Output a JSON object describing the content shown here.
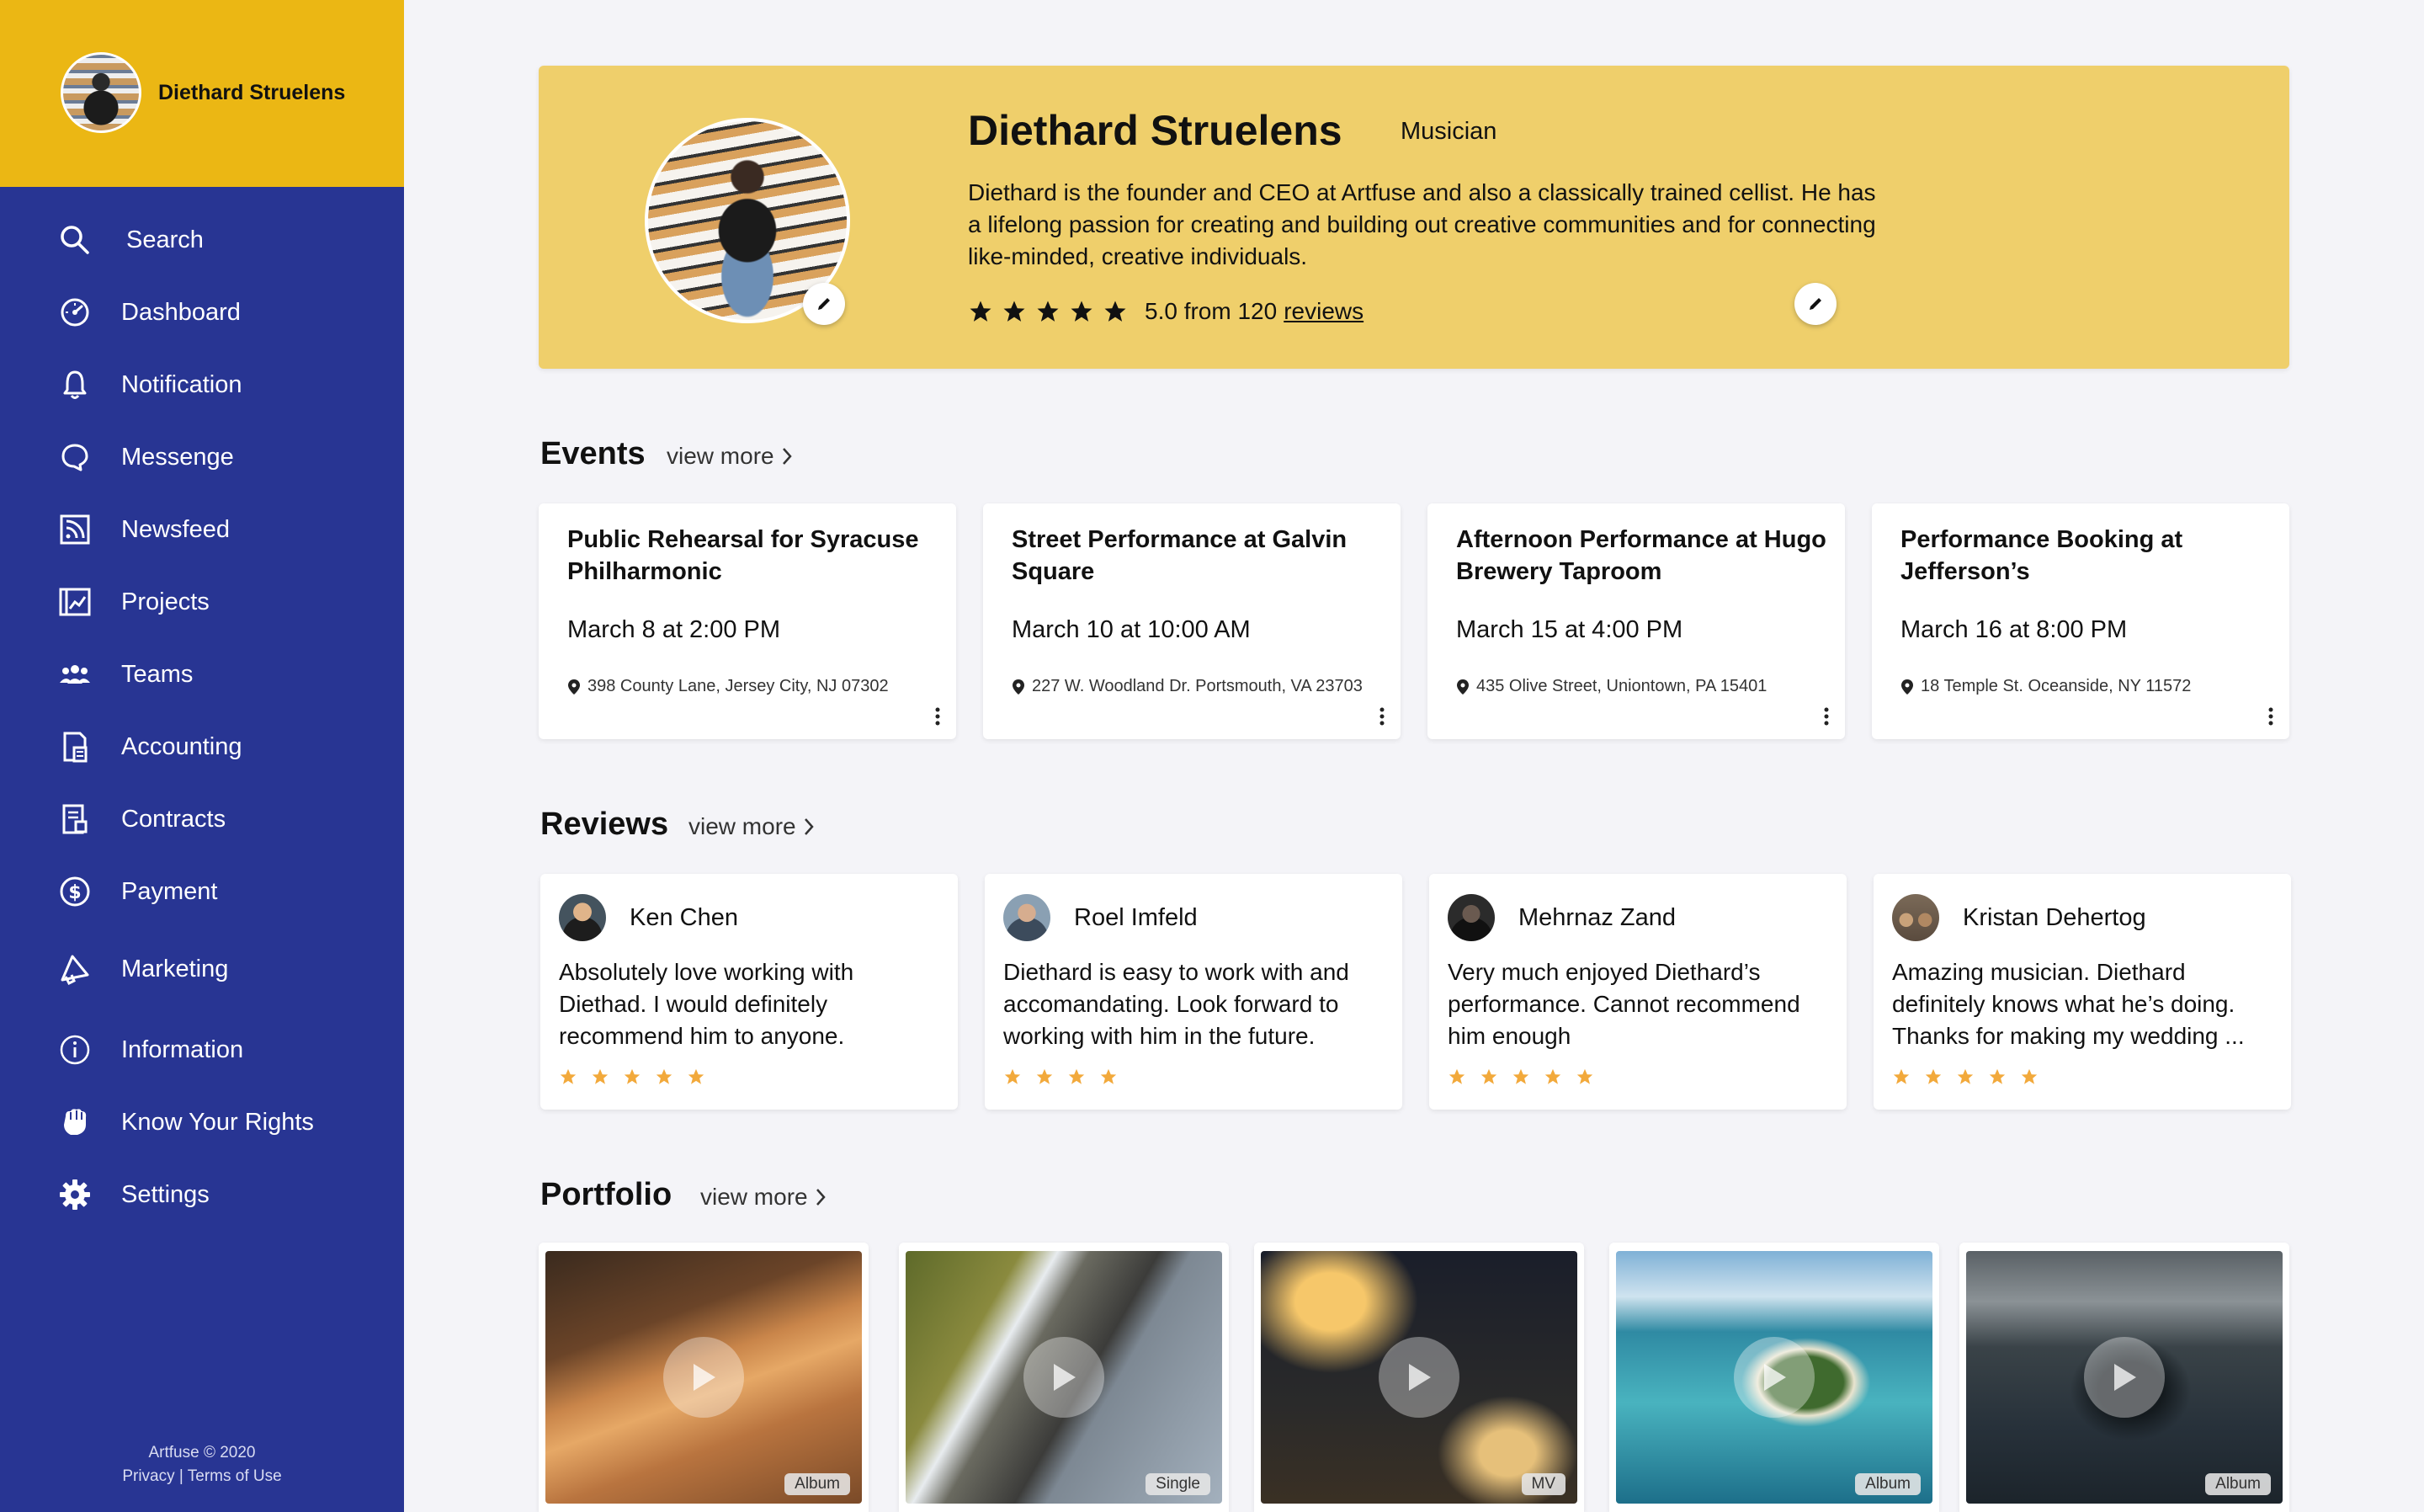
{
  "sidebar": {
    "profile_name": "Diethard Struelens",
    "items": [
      {
        "label": "Search",
        "icon": "search-icon"
      },
      {
        "label": "Dashboard",
        "icon": "dashboard-icon"
      },
      {
        "label": "Notification",
        "icon": "bell-icon"
      },
      {
        "label": "Messenge",
        "icon": "chat-bubble-icon"
      },
      {
        "label": "Newsfeed",
        "icon": "rss-feed-icon"
      },
      {
        "label": "Projects",
        "icon": "projects-chart-icon"
      },
      {
        "label": "Teams",
        "icon": "teams-icon"
      },
      {
        "label": "Accounting",
        "icon": "accounting-icon"
      },
      {
        "label": "Contracts",
        "icon": "contracts-icon"
      },
      {
        "label": "Payment",
        "icon": "dollar-icon"
      },
      {
        "label": "Marketing",
        "icon": "megaphone-icon"
      },
      {
        "label": "Information",
        "icon": "info-icon"
      },
      {
        "label": "Know Your Rights",
        "icon": "fist-icon"
      },
      {
        "label": "Settings",
        "icon": "gear-icon"
      }
    ],
    "footer": {
      "copyright": "Artfuse © 2020",
      "privacy": "Privacy",
      "separator": "|",
      "terms": "Terms of Use"
    }
  },
  "profile": {
    "name": "Diethard Struelens",
    "role": "Musician",
    "bio": "Diethard is the founder and CEO at Artfuse and also a classically trained cellist. He has a lifelong passion for creating and building out creative communities and for connecting like-minded, creative individuals.",
    "rating_text": "5.0 from 120",
    "reviews_link": "reviews",
    "stars": 5
  },
  "events": {
    "title": "Events",
    "view_more": "view more",
    "items": [
      {
        "title": "Public Rehearsal for Syracuse Philharmonic",
        "date": "March 8 at 2:00 PM",
        "location": "398 County Lane, Jersey City, NJ 07302"
      },
      {
        "title": "Street Performance at Galvin Square",
        "date": "March 10 at 10:00 AM",
        "location": "227 W. Woodland Dr. Portsmouth, VA 23703"
      },
      {
        "title": "Afternoon Performance at Hugo Brewery Taproom",
        "date": "March 15 at 4:00 PM",
        "location": "435 Olive Street, Uniontown, PA 15401"
      },
      {
        "title": "Performance Booking at Jefferson’s",
        "date": "March 16 at 8:00 PM",
        "location": "18 Temple St. Oceanside, NY 11572"
      }
    ]
  },
  "reviews": {
    "title": "Reviews",
    "view_more": "view more",
    "items": [
      {
        "name": "Ken Chen",
        "text": "Absolutely love working with Diethad. I would definitely recommend him to anyone.",
        "stars": 5
      },
      {
        "name": "Roel Imfeld",
        "text": "Diethard is easy to work with and accomandating. Look forward to working with him in the future.",
        "stars": 4
      },
      {
        "name": "Mehrnaz Zand",
        "text": "Very much enjoyed Diethard’s performance. Cannot recommend him enough",
        "stars": 5
      },
      {
        "name": "Kristan Dehertog",
        "text": "Amazing musician. Diethard definitely knows what he’s doing. Thanks for making my wedding ...",
        "stars": 5
      }
    ]
  },
  "portfolio": {
    "title": "Portfolio",
    "view_more": "view more",
    "items": [
      {
        "tag": "Album"
      },
      {
        "tag": "Single"
      },
      {
        "tag": "MV"
      },
      {
        "tag": "Album"
      },
      {
        "tag": "Album"
      }
    ]
  },
  "colors": {
    "sidebar": "#283593",
    "sidebar_header": "#ebb714",
    "hero": "#efcf6b",
    "star_accent": "#f2a93b"
  }
}
